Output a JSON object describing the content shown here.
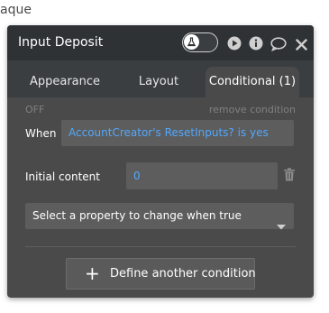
{
  "background": {
    "text": "aque"
  },
  "panel": {
    "title": "Input Deposit",
    "icons": [
      "flask-icon",
      "play-icon",
      "info-icon",
      "comment-icon",
      "close-icon"
    ]
  },
  "tabs": [
    {
      "label": "Appearance",
      "active": false
    },
    {
      "label": "Layout",
      "active": false
    },
    {
      "label": "Conditional (1)",
      "active": true
    }
  ],
  "conditional": {
    "status": "OFF",
    "remove_label": "remove condition",
    "when_label": "When",
    "when_expression": "AccountCreator's ResetInputs? is yes",
    "property_label": "Initial content",
    "property_value": "0",
    "select_placeholder": "Select a property to change when true",
    "define_button_label": "Define another condition"
  },
  "colors": {
    "panel_bg": "#4a4a4a",
    "header_bg": "#2e3235",
    "tab_bar_bg": "#3a3e41",
    "field_bg": "#5d5d5d",
    "expression_blue": "#52a8ff"
  }
}
